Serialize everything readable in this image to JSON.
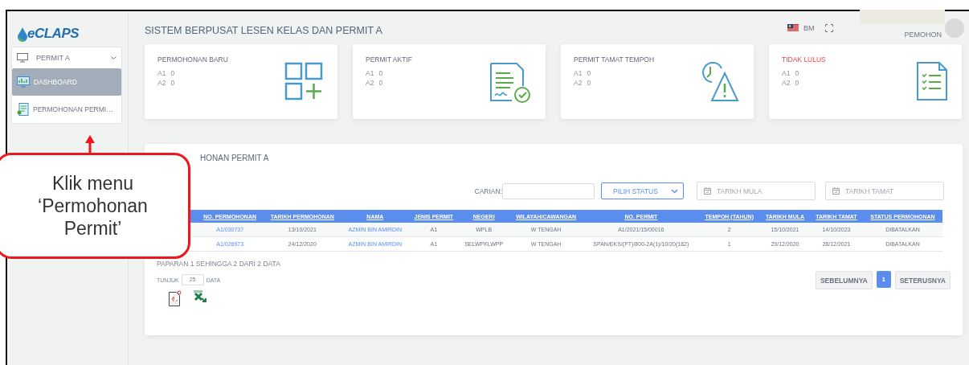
{
  "sidebar": {
    "logo": "eCLAPS",
    "menu": {
      "label": "PERMIT A",
      "expanded": true
    },
    "items": [
      {
        "label": "DASHBOARD",
        "kind": "dashboard",
        "selected": true
      },
      {
        "label": "PERMOHONAN PERMI…",
        "kind": "form",
        "selected": false
      }
    ]
  },
  "header": {
    "title": "SISTEM BERPUSAT LESEN KELAS DAN PERMIT A",
    "language": "BM",
    "user": "PEMOHON"
  },
  "cards": [
    {
      "title": "PERMOHONAN BARU",
      "alert": false,
      "kind": "apps",
      "rows": [
        {
          "label": "A1",
          "value": "0"
        },
        {
          "label": "A2",
          "value": "0"
        }
      ]
    },
    {
      "title": "PERMIT AKTIF",
      "alert": false,
      "kind": "signed-document",
      "rows": [
        {
          "label": "A1",
          "value": "0"
        },
        {
          "label": "A2",
          "value": "0"
        }
      ]
    },
    {
      "title": "PERMIT TAMAT TEMPOH",
      "alert": false,
      "kind": "clock-warning",
      "rows": [
        {
          "label": "A1",
          "value": "0"
        },
        {
          "label": "A2",
          "value": "0"
        }
      ]
    },
    {
      "title": "TIDAK LULUS",
      "alert": true,
      "kind": "checklist",
      "rows": [
        {
          "label": "A1",
          "value": "0"
        },
        {
          "label": "A2",
          "value": "0"
        }
      ]
    }
  ],
  "table_panel": {
    "title": "HONAN PERMIT A",
    "search_label": "CARIAN:",
    "status_select": "PILIH STATUS",
    "start_date": {
      "placeholder": "TARIKH MULA"
    },
    "end_date": {
      "placeholder": "TARIKH TAMAT"
    },
    "columns": [
      {
        "label": "NO. PERMOHONAN",
        "kind": "link"
      },
      {
        "label": "TARIKH PERMOHONAN",
        "kind": "text"
      },
      {
        "label": "NAMA",
        "kind": "link"
      },
      {
        "label": "JENIS PERMIT",
        "kind": "text"
      },
      {
        "label": "NEGERI",
        "kind": "text"
      },
      {
        "label": "WILAYAH/CAWANGAN",
        "kind": "text"
      },
      {
        "label": "NO. PERMIT",
        "kind": "text"
      },
      {
        "label": "TEMPOH (TAHUN)",
        "kind": "text"
      },
      {
        "label": "TARIKH MULA",
        "kind": "text"
      },
      {
        "label": "TARIKH TAMAT",
        "kind": "text"
      },
      {
        "label": "STATUS PERMOHONAN",
        "kind": "text"
      }
    ],
    "rows": [
      [
        "A1/030737",
        "13/10/2021",
        "AZMIN BIN AMIRDIN",
        "A1",
        "WPLB",
        "W TENGAH",
        "A1/2021/15/00016",
        "2",
        "15/10/2021",
        "14/10/2023",
        "DIBATALKAN"
      ],
      [
        "A1/026973",
        "24/12/2020",
        "AZMIN BIN AMIRDIN",
        "A1",
        "SELWPKLWPP",
        "W TENGAH",
        "SPAN/EKS/(PT)/800-2A(1)/10/20(182)",
        "1",
        "29/12/2020",
        "28/12/2021",
        "DIBATALKAN"
      ]
    ],
    "summary": "PAPARAN 1 SEHINGGA 2 DARI 2 DATA",
    "page_size": {
      "label": "TUNJUK",
      "value": "25",
      "suffix": "DATA"
    },
    "pagination": {
      "previous": "SEBELUMNYA",
      "pages": [
        {
          "label": "1",
          "selected": true
        }
      ],
      "next": "SETERUSNYA"
    }
  },
  "callout": {
    "text": "Klik menu\n‘Permohonan\nPermit’"
  }
}
